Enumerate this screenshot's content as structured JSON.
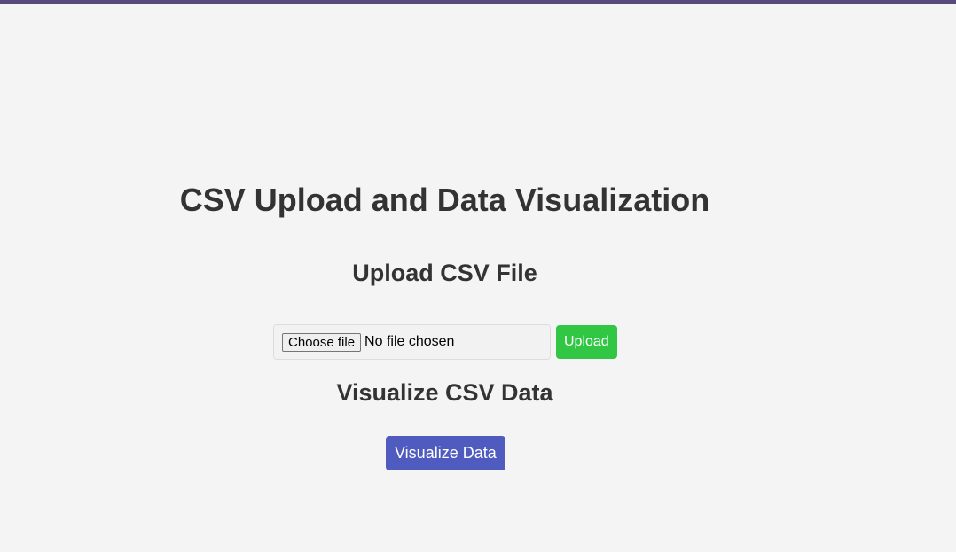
{
  "page": {
    "title": "CSV Upload and Data Visualization"
  },
  "upload_section": {
    "heading": "Upload CSV File",
    "choose_file_label": "Choose file",
    "file_status": "No file chosen",
    "upload_button_label": "Upload"
  },
  "visualize_section": {
    "heading": "Visualize CSV Data",
    "button_label": "Visualize Data"
  },
  "colors": {
    "background": "#f4f4f4",
    "top_bar": "#5a4a7c",
    "text": "#333333",
    "upload_button": "#31c744",
    "visualize_button": "#4f5bbf"
  }
}
